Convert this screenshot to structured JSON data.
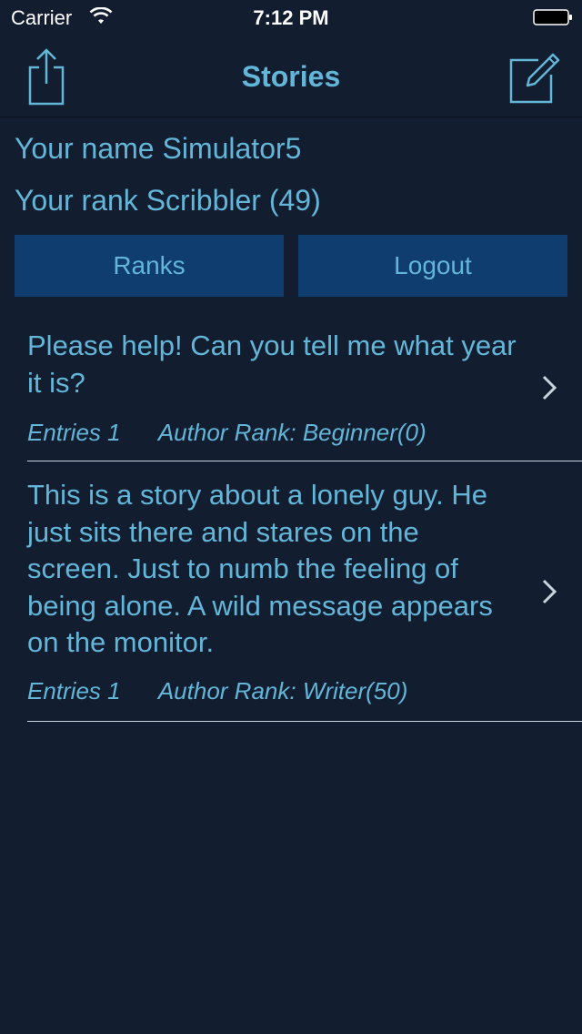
{
  "status_bar": {
    "carrier": "Carrier",
    "time": "7:12 PM"
  },
  "nav": {
    "title": "Stories",
    "left_icon": "share-icon",
    "right_icon": "compose-icon"
  },
  "profile": {
    "name_line": "Your name Simulator5",
    "rank_line": "Your rank Scribbler (49)"
  },
  "buttons": {
    "ranks": "Ranks",
    "logout": "Logout"
  },
  "stories": [
    {
      "text": "Please help! Can you tell me what year it is?",
      "entries": "Entries 1",
      "author_rank": "Author Rank: Beginner(0)"
    },
    {
      "text": "This is a story about a lonely guy. He just sits there and stares on the screen. Just to numb the feeling of being alone. A wild message appears on the monitor.",
      "entries": "Entries 1",
      "author_rank": "Author Rank: Writer(50)"
    }
  ],
  "colors": {
    "background": "#121d30",
    "accent_text": "#63b6d8",
    "button_bg": "#0f3d70",
    "separator": "#c8d4de"
  }
}
